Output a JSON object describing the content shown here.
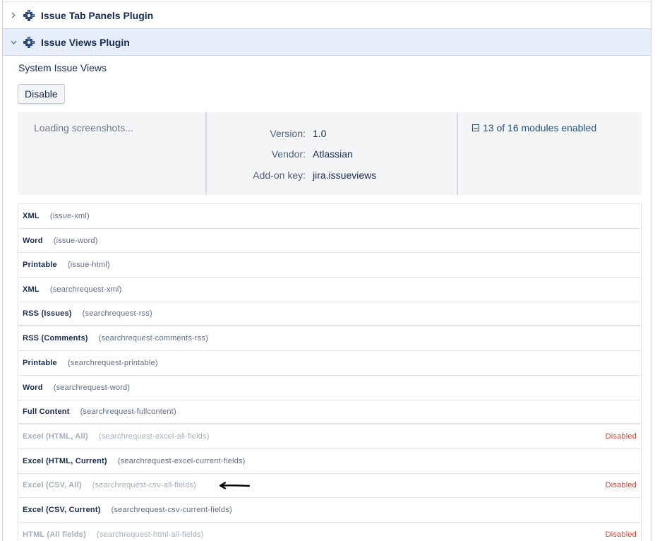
{
  "plugins": [
    {
      "name": "Issue Tab Panels Plugin",
      "state": "collapsed"
    },
    {
      "name": "Issue Views Plugin",
      "state": "expanded"
    }
  ],
  "icons": {
    "collapsed": "chevron-right-icon",
    "expanded": "chevron-down-icon",
    "plugin": "plugin-puzzle-icon"
  },
  "detail": {
    "subtitle": "System Issue Views",
    "disable_button": "Disable",
    "screenshots_text": "Loading screenshots...",
    "fields": [
      {
        "label": "Version:",
        "value": "1.0"
      },
      {
        "label": "Vendor:",
        "value": "Atlassian"
      },
      {
        "label": "Add-on key:",
        "value": "jira.issueviews"
      }
    ],
    "modules_link": "13 of 16 modules enabled"
  },
  "modules": [
    {
      "name": "XML",
      "key": "(issue-xml)",
      "status": ""
    },
    {
      "name": "Word",
      "key": "(issue-word)",
      "status": ""
    },
    {
      "name": "Printable",
      "key": "(issue-html)",
      "status": ""
    },
    {
      "name": "XML",
      "key": "(searchrequest-xml)",
      "status": ""
    },
    {
      "name": "RSS (Issues)",
      "key": "(searchrequest-rss)",
      "status": ""
    },
    {
      "name": "RSS (Comments)",
      "key": "(searchrequest-comments-rss)",
      "status": ""
    },
    {
      "name": "Printable",
      "key": "(searchrequest-printable)",
      "status": ""
    },
    {
      "name": "Word",
      "key": "(searchrequest-word)",
      "status": ""
    },
    {
      "name": "Full Content",
      "key": "(searchrequest-fullcontent)",
      "status": ""
    },
    {
      "name": "Excel (HTML, All)",
      "key": "(searchrequest-excel-all-fields)",
      "status": "Disabled"
    },
    {
      "name": "Excel (HTML, Current)",
      "key": "(searchrequest-excel-current-fields)",
      "status": ""
    },
    {
      "name": "Excel (CSV, All)",
      "key": "(searchrequest-csv-all-fields)",
      "status": "Disabled"
    },
    {
      "name": "Excel (CSV, Current)",
      "key": "(searchrequest-csv-current-fields)",
      "status": ""
    },
    {
      "name": "HTML (All fields)",
      "key": "(searchrequest-html-all-fields)",
      "status": "Disabled"
    }
  ],
  "colors": {
    "link": "#205081",
    "disabled_status": "#d04437",
    "expanded_row_bg": "#e8eef9",
    "panel_bg": "#f4f5f7"
  }
}
